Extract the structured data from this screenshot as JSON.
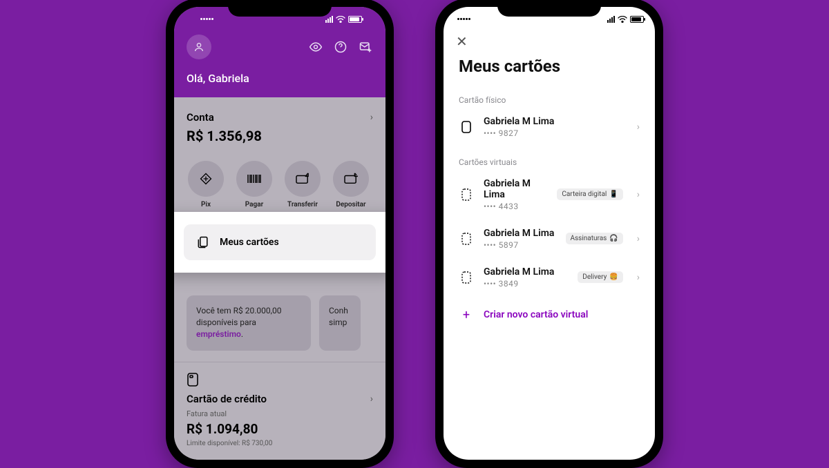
{
  "home": {
    "greeting": "Olá, Gabriela",
    "account": {
      "label": "Conta",
      "balance": "R$ 1.356,98"
    },
    "actions": [
      {
        "label": "Pix"
      },
      {
        "label": "Pagar"
      },
      {
        "label": "Transferir"
      },
      {
        "label": "Depositar"
      }
    ],
    "my_cards_label": "Meus cartões",
    "tip1_line1": "Você tem R$ 20.000,00",
    "tip1_line2a": "disponíveis para ",
    "tip1_line2b": "empréstimo",
    "tip1_line2c": ".",
    "tip2_partial1": "Conh",
    "tip2_partial2": "simp",
    "credit": {
      "title": "Cartão de crédito",
      "sub": "Fatura atual",
      "amount": "R$ 1.094,80",
      "limit": "Limite disponível: R$ 730,00"
    }
  },
  "cards": {
    "title": "Meus cartões",
    "physical_label": "Cartão físico",
    "virtual_label": "Cartões virtuais",
    "physical": {
      "name": "Gabriela M Lima",
      "last4": "•••• 9827"
    },
    "virtual": [
      {
        "name": "Gabriela M Lima",
        "last4": "•••• 4433",
        "tag": "Carteira digital",
        "emoji": "📱"
      },
      {
        "name": "Gabriela M Lima",
        "last4": "•••• 5897",
        "tag": "Assinaturas",
        "emoji": "🎧"
      },
      {
        "name": "Gabriela M Lima",
        "last4": "•••• 3849",
        "tag": "Delivery",
        "emoji": "🍔"
      }
    ],
    "create_label": "Criar novo cartão virtual"
  }
}
